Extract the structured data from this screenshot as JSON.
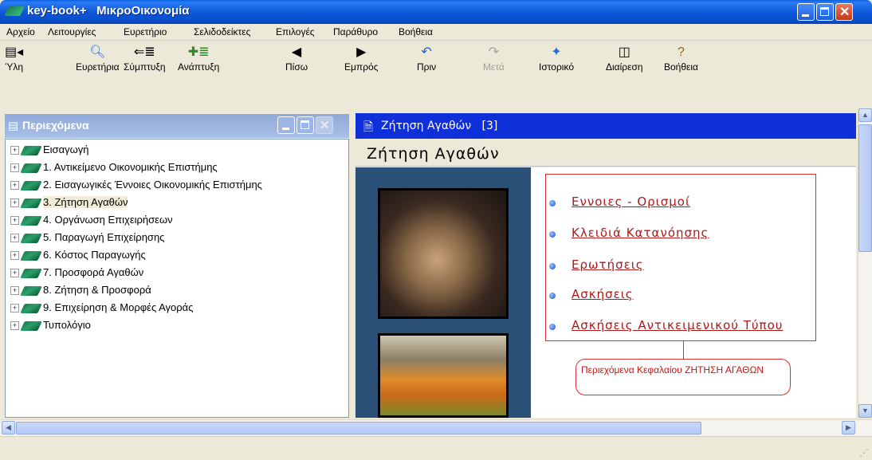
{
  "window": {
    "title": "key-book+   ΜικροΟικονομία"
  },
  "menu": [
    "Αρχείο",
    "Λειτουργίες",
    "Ευρετήριο",
    "Σελιδοδείκτες",
    "Επιλογές",
    "Παράθυρο",
    "Βοήθεια"
  ],
  "toolbar": [
    {
      "label": "Ύλη",
      "icon": "toc-icon"
    },
    {
      "label": "Ευρετήρια",
      "icon": "search-icon"
    },
    {
      "label": "Σύμπτυξη",
      "icon": "collapse-icon"
    },
    {
      "label": "Ανάπτυξη",
      "icon": "expand-icon"
    },
    {
      "label": "Πίσω",
      "icon": "back-arrow-icon"
    },
    {
      "label": "Εμπρός",
      "icon": "forward-arrow-icon"
    },
    {
      "label": "Πριν",
      "icon": "undo-icon"
    },
    {
      "label": "Μετά",
      "icon": "redo-icon",
      "disabled": true
    },
    {
      "label": "Ιστορικό",
      "icon": "history-icon"
    },
    {
      "label": "Διαίρεση",
      "icon": "split-icon"
    },
    {
      "label": "Βοήθεια",
      "icon": "help-icon"
    }
  ],
  "left_panel": {
    "title": "Περιεχόμενα",
    "tree": [
      "Εισαγωγή",
      "1. Αντικείμενο Οικονομικής Επιστήμης",
      "2. Εισαγωγικές Έννοιες Οικονομικής Επιστήμης",
      "3. Ζήτηση Αγαθών",
      "4. Οργάνωση Επιχειρήσεων",
      "5. Παραγωγή Επιχείρησης",
      "6. Κόστος Παραγωγής",
      "7. Προσφορά Αγαθών",
      "8. Ζήτηση & Προσφορά",
      "9. Επιχείρηση & Μορφές Αγοράς",
      "Τυπολόγιο"
    ],
    "selected_index": 3
  },
  "right_panel": {
    "header": "Ζήτηση Αγαθών   [3]",
    "page_title": "Ζήτηση Αγαθών",
    "links": [
      "Εννοιες - Ορισμοί",
      "Κλειδιά Κατανόησης",
      "Ερωτήσεις",
      "Ασκήσεις",
      "Ασκήσεις Αντικειμενικού Τύπου"
    ],
    "callout": "Περιεχόμενα Κεφαλαίου  ΖΗΤΗΣΗ ΑΓΑΘΩΝ"
  },
  "colors": {
    "titlebar": "#0b56d8",
    "link": "#b01818",
    "accent_red": "#d93030",
    "right_header": "#0f2fd9"
  }
}
